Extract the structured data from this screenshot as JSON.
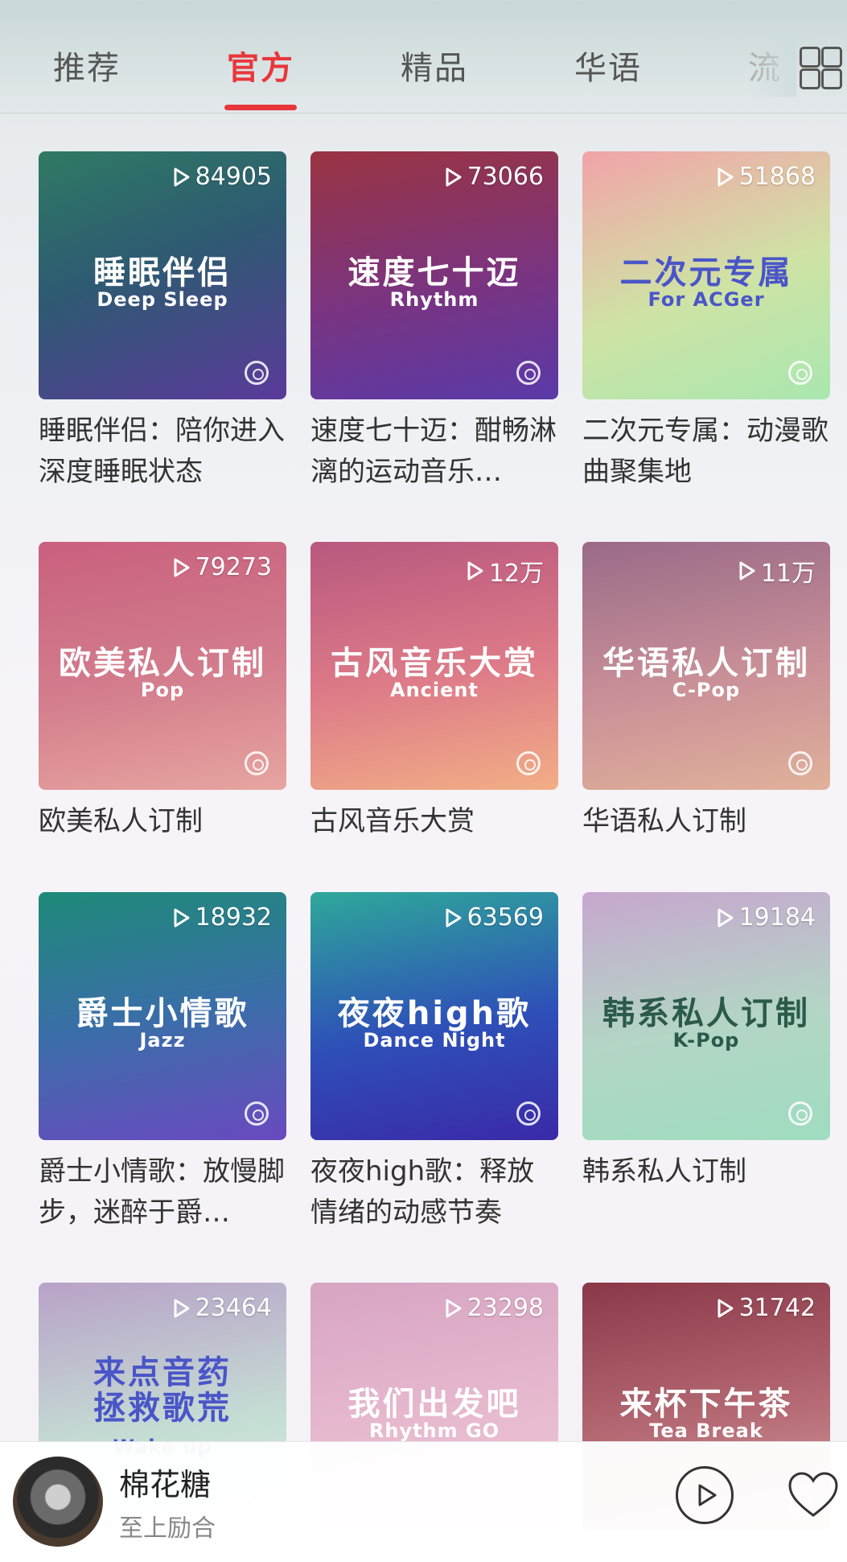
{
  "tabs": [
    "推荐",
    "官方",
    "精品",
    "华语",
    "流"
  ],
  "active_tab": "官方",
  "cards": [
    {
      "count": "84905",
      "cover_title": "睡眠伴侣",
      "cover_sub": "Deep Sleep",
      "title": "睡眠伴侣：陪你进入深度睡眠状态"
    },
    {
      "count": "73066",
      "cover_title": "速度七十迈",
      "cover_sub": "Rhythm",
      "title": "速度七十迈：酣畅淋漓的运动音乐…"
    },
    {
      "count": "51868",
      "cover_title": "二次元专属",
      "cover_sub": "For ACGer",
      "title": "二次元专属：动漫歌曲聚集地"
    },
    {
      "count": "79273",
      "cover_title": "欧美私人订制",
      "cover_sub": "Pop",
      "title": "欧美私人订制"
    },
    {
      "count": "12万",
      "cover_title": "古风音乐大赏",
      "cover_sub": "Ancient",
      "title": "古风音乐大赏"
    },
    {
      "count": "11万",
      "cover_title": "华语私人订制",
      "cover_sub": "C-Pop",
      "title": "华语私人订制"
    },
    {
      "count": "18932",
      "cover_title": "爵士小情歌",
      "cover_sub": "Jazz",
      "title": "爵士小情歌：放慢脚步，迷醉于爵…"
    },
    {
      "count": "63569",
      "cover_title": "夜夜high歌",
      "cover_sub": "Dance Night",
      "title": "夜夜high歌：释放情绪的动感节奏"
    },
    {
      "count": "19184",
      "cover_title": "韩系私人订制",
      "cover_sub": "K-Pop",
      "title": "韩系私人订制"
    },
    {
      "count": "23464",
      "cover_title": "来点音药拯救歌荒",
      "cover_sub": "Wake up",
      "title": ""
    },
    {
      "count": "23298",
      "cover_title": "我们出发吧",
      "cover_sub": "Rhythm GO",
      "title": ""
    },
    {
      "count": "31742",
      "cover_title": "来杯下午茶",
      "cover_sub": "Tea Break",
      "title": ""
    }
  ],
  "player": {
    "song": "棉花糖",
    "artist": "至上励合"
  },
  "colors": {
    "accent": "#e8373b"
  }
}
